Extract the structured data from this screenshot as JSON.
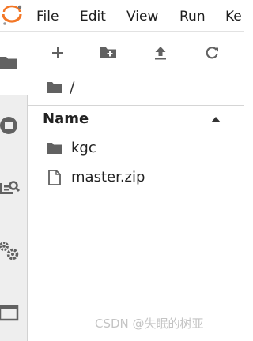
{
  "menubar": {
    "items": [
      "File",
      "Edit",
      "View",
      "Run",
      "Ke"
    ]
  },
  "toolbar": {
    "buttons": [
      "plus-icon",
      "new-folder-icon",
      "upload-icon",
      "refresh-icon"
    ]
  },
  "sidebar": {
    "icons": [
      "folder-icon",
      "stop-circle-icon",
      "search-list-icon",
      "gears-icon",
      "window-icon"
    ]
  },
  "breadcrumb": {
    "path": "/"
  },
  "filelist": {
    "header": "Name",
    "items": [
      {
        "name": "kgc",
        "type": "folder"
      },
      {
        "name": "master.zip",
        "type": "file"
      }
    ]
  },
  "watermark": "CSDN @失眠的树亚",
  "colors": {
    "logo_orange": "#f37726",
    "icon_gray": "#616161",
    "sidebar_bg": "#eeeeee"
  }
}
